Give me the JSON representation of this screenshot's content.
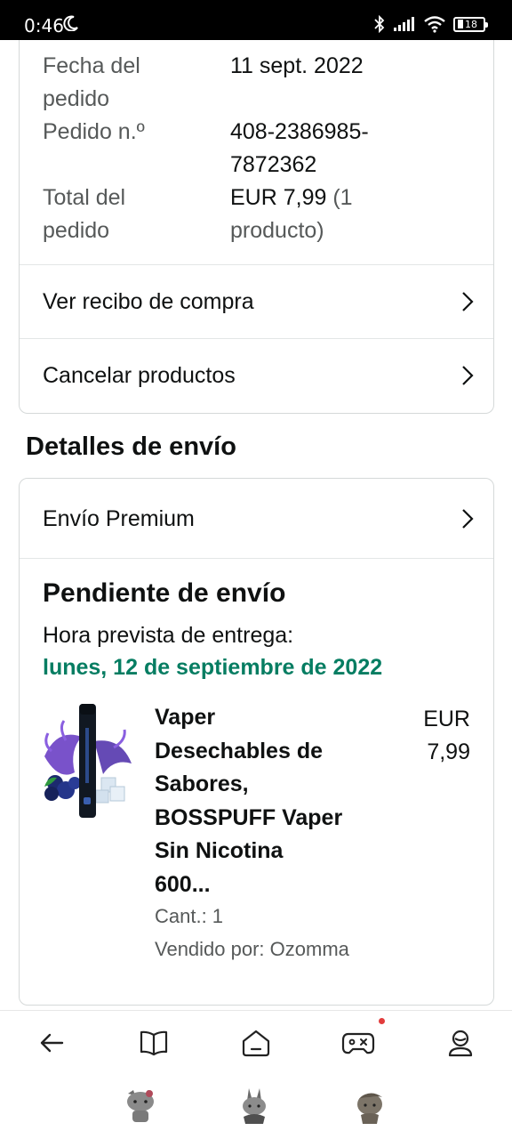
{
  "status_bar": {
    "time": "0:46",
    "battery": "18"
  },
  "order_info": {
    "date_label": "Fecha del pedido",
    "date_label_l1": "Fecha del",
    "date_label_l2": "pedido",
    "date_value": "11 sept. 2022",
    "number_label": "Pedido n.º",
    "number_value_l1": "408-2386985-",
    "number_value_l2": "7872362",
    "total_label_l1": "Total del",
    "total_label_l2": "pedido",
    "total_value_l1": "EUR 7,99",
    "total_value_l1_muted": "(1",
    "total_value_l2": "producto)"
  },
  "links": {
    "receipt": "Ver recibo de compra",
    "cancel": "Cancelar productos"
  },
  "shipping": {
    "section_title": "Detalles de envío",
    "method": "Envío Premium",
    "status": "Pendiente de envío",
    "eta_label": "Hora prevista de entrega:",
    "eta_date": "lunes, 12 de septiembre de 2022"
  },
  "product": {
    "title_lines": [
      "Vaper",
      "Desechables de",
      "Sabores,",
      "BOSSPUFF Vaper",
      "Sin Nicotina",
      "600..."
    ],
    "price_l1": "EUR",
    "price_l2": "7,99",
    "qty": "Cant.: 1",
    "seller": "Vendido por: Ozomma",
    "image_icon": "vape-product-image"
  },
  "bottom_nav": {
    "items": [
      "back-icon",
      "book-icon",
      "home-icon",
      "gamepad-icon",
      "profile-icon"
    ]
  },
  "colors": {
    "green": "#067d62",
    "text": "#0f1111",
    "muted": "#565959",
    "border": "#d5d9d9"
  }
}
